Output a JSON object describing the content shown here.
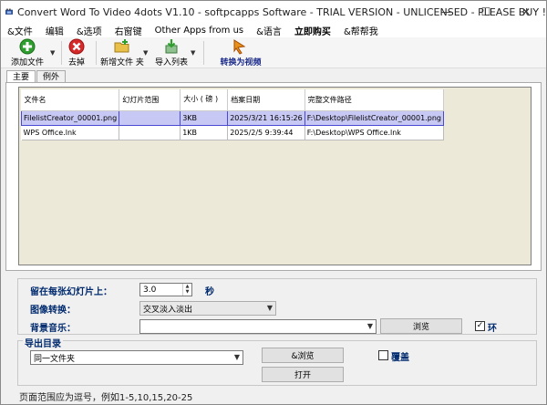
{
  "window": {
    "title": "Convert Word To Video 4dots V1.10 - softpcapps Software - TRIAL VERSION - UNLICENSED - PLEASE BUY !",
    "minimize": "—",
    "maximize": "☐",
    "close": "✕"
  },
  "menu": [
    "&文件",
    "编辑",
    "&选项",
    "右窗键",
    "Other Apps from us",
    "&语言",
    "立即购买",
    "&帮帮我"
  ],
  "toolbar": {
    "add_file": "添加文件",
    "remove": "去掉",
    "new_folder": "新增文件 夹",
    "import_list": "导入列表",
    "convert": "转换为视频",
    "dropdown_arrow": "▼"
  },
  "tabs": [
    "主要",
    "例外"
  ],
  "table": {
    "columns": [
      "文件名",
      "幻灯片范围",
      "大小 ( 磅 )",
      "档案日期",
      "完整文件路径"
    ],
    "rows": [
      {
        "name": "FilelistCreator_00001.png",
        "range": "",
        "size": "3KB",
        "date": "2025/3/21 16:15:26",
        "path": "F:\\Desktop\\FilelistCreator_00001.png",
        "selected": true
      },
      {
        "name": "WPS Office.lnk",
        "range": "",
        "size": "1KB",
        "date": "2025/2/5 9:39:44",
        "path": "F:\\Desktop\\WPS Office.lnk",
        "selected": false
      }
    ]
  },
  "options": {
    "stay_label": "留在每张幻灯片上：",
    "stay_value": "3.0",
    "seconds": "秒",
    "transition_label": "图像转换：",
    "transition_value": "交叉淡入淡出",
    "bgmusic_label": "背景音乐：",
    "bgmusic_value": "",
    "browse": "浏览",
    "loop_label": "环",
    "loop_checked": "✓"
  },
  "output": {
    "header": "导出目录",
    "folder_value": "同一文件夹",
    "browse": "&浏览",
    "open": "打开",
    "overwrite_label": "覆盖"
  },
  "footer": "页面范围应为逗号，例如1-5,10,15,20-25"
}
